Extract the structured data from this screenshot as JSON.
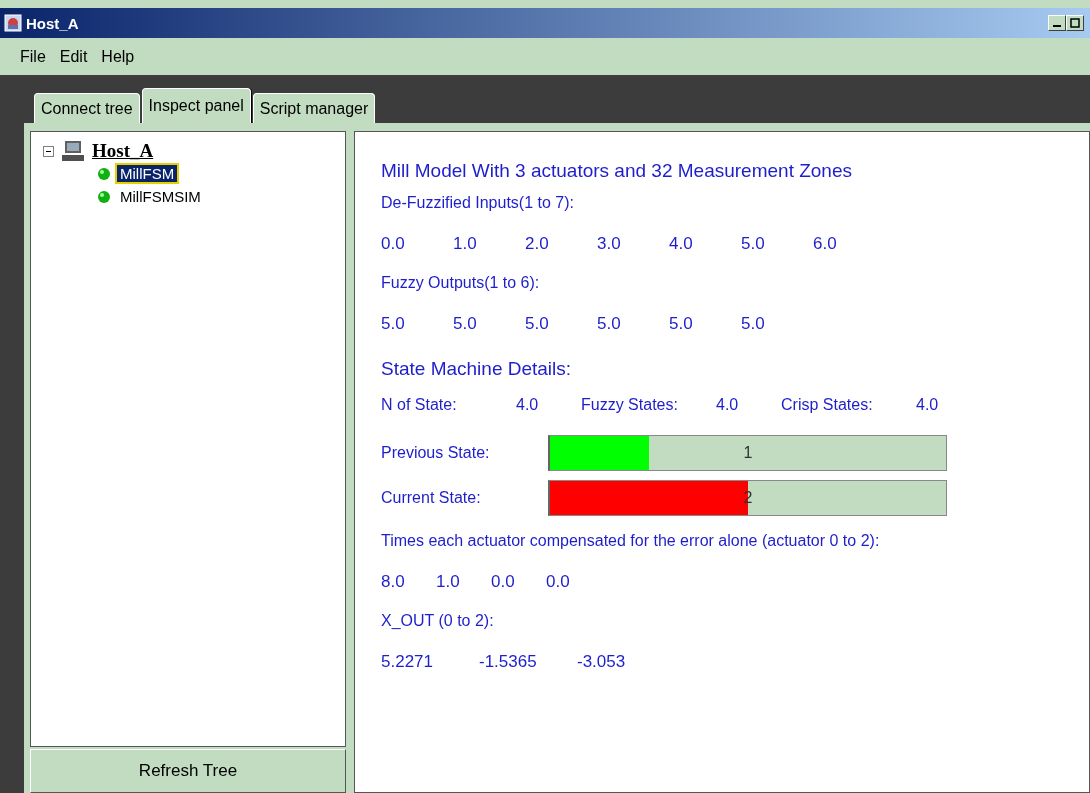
{
  "window": {
    "title": "Host_A"
  },
  "menu": [
    "File",
    "Edit",
    "Help"
  ],
  "tabs": [
    {
      "label": "Connect tree",
      "selected": false
    },
    {
      "label": "Inspect panel",
      "selected": true
    },
    {
      "label": "Script manager",
      "selected": false
    }
  ],
  "tree": {
    "label": "Host_A",
    "expanded": true,
    "children": [
      {
        "label": "MillFSM",
        "selected": true
      },
      {
        "label": "MillFSMSIM",
        "selected": false
      }
    ]
  },
  "refresh_button": "Refresh Tree",
  "inspect": {
    "title": "Mill Model With 3 actuators and 32 Measurement Zones",
    "inputs_label": "De-Fuzzified Inputs(1 to 7):",
    "inputs": [
      "0.0",
      "1.0",
      "2.0",
      "3.0",
      "4.0",
      "5.0",
      "6.0"
    ],
    "outputs_label": "Fuzzy Outputs(1 to 6):",
    "outputs": [
      "5.0",
      "5.0",
      "5.0",
      "5.0",
      "5.0",
      "5.0"
    ],
    "state_title": "State Machine Details:",
    "state_counts": [
      {
        "label": "N of State:",
        "value": "4.0"
      },
      {
        "label": "Fuzzy States:",
        "value": "4.0"
      },
      {
        "label": "Crisp States:",
        "value": "4.0"
      }
    ],
    "state_bars": [
      {
        "label": "Previous State:",
        "reading": "1",
        "level": 0.25,
        "color": "#00ff00"
      },
      {
        "label": "Current State:",
        "reading": "2",
        "level": 0.5,
        "color": "#ff0000"
      }
    ],
    "times_label": "Times each actuator compensated for the error alone (actuator 0 to 2):",
    "times": [
      "8.0",
      "1.0",
      "0.0",
      "0.0"
    ],
    "xout_label": "X_OUT (0 to 2):",
    "xout": [
      "5.2271",
      "-1.5365",
      "-3.053"
    ]
  }
}
